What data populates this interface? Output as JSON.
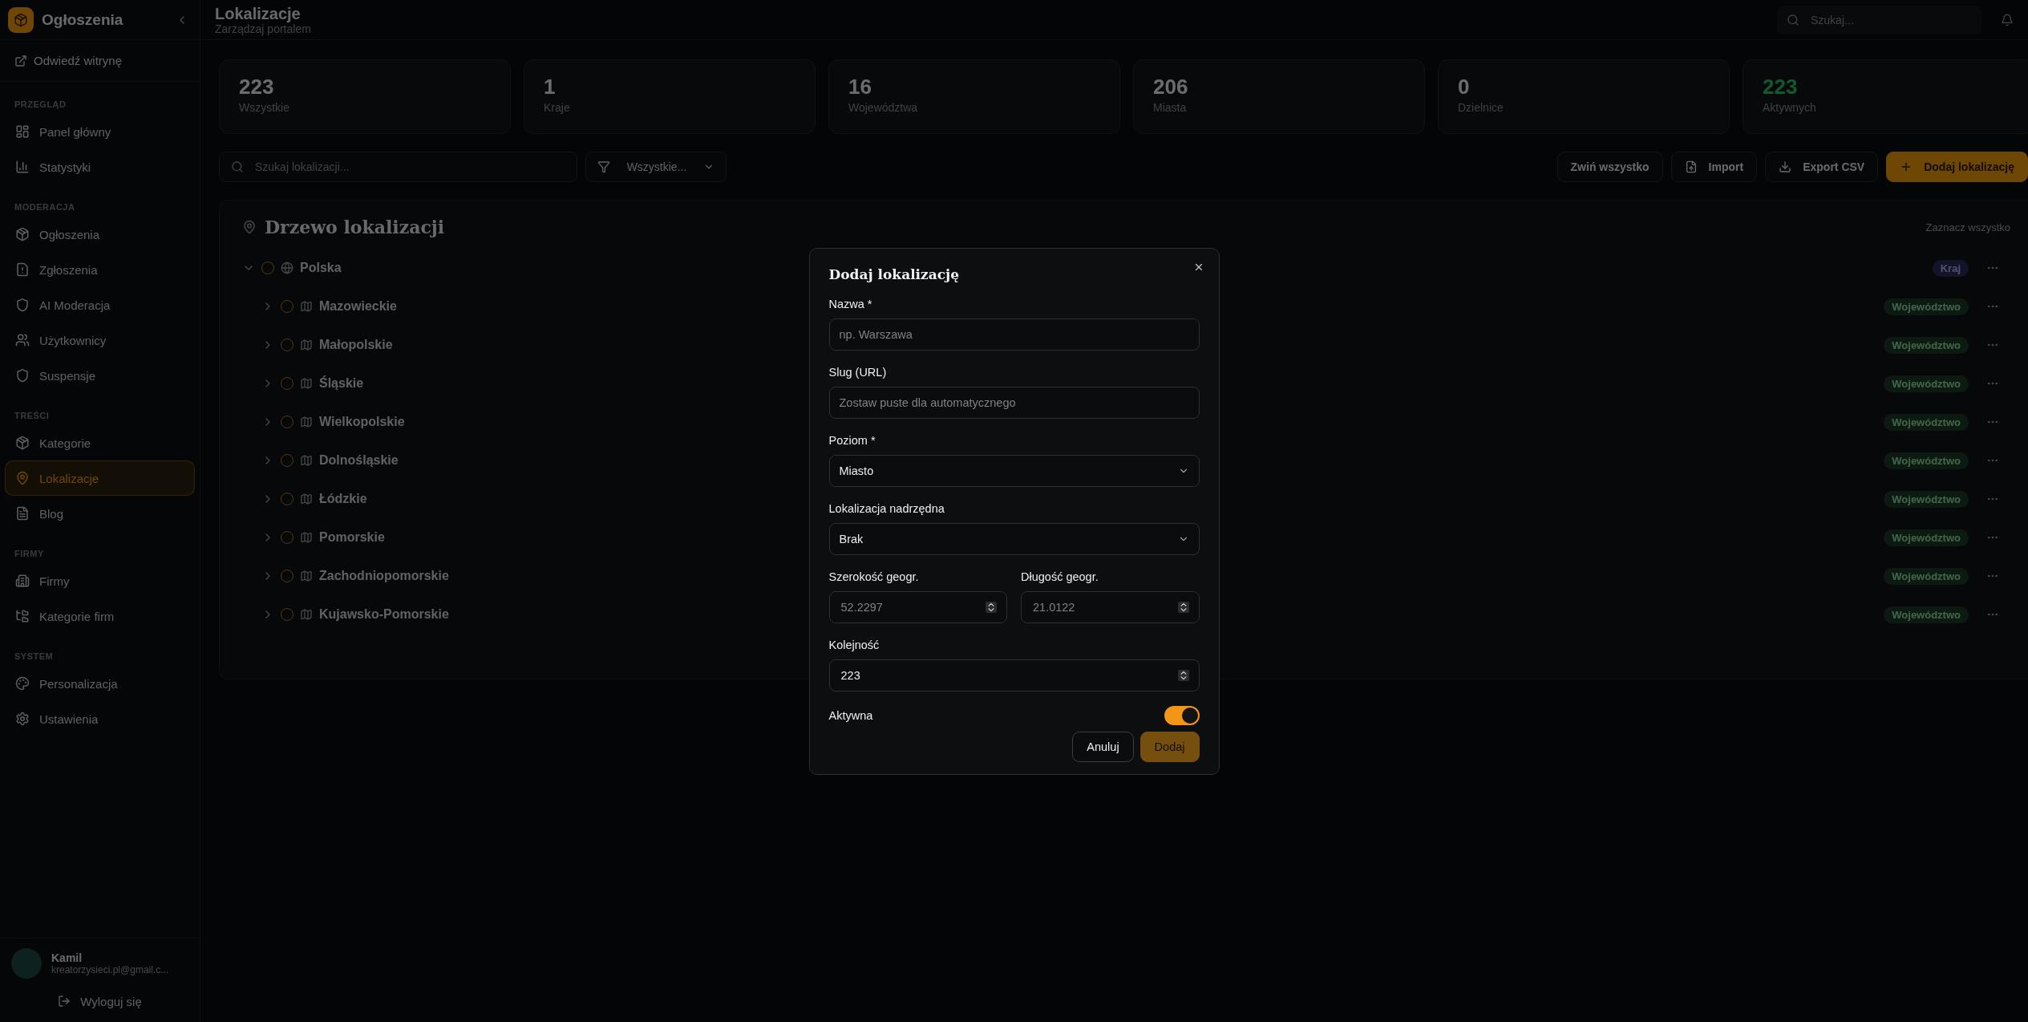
{
  "sidebar": {
    "brand": "Ogłoszenia",
    "visit_link": "Odwiedź witrynę",
    "sections": [
      {
        "title": "PRZEGLĄD",
        "items": [
          {
            "label": "Panel główny",
            "selected": false
          },
          {
            "label": "Statystyki",
            "selected": false
          }
        ]
      },
      {
        "title": "MODERACJA",
        "items": [
          {
            "label": "Ogłoszenia",
            "selected": false
          },
          {
            "label": "Zgłoszenia",
            "selected": false
          },
          {
            "label": "AI Moderacja",
            "selected": false
          },
          {
            "label": "Użytkownicy",
            "selected": false
          },
          {
            "label": "Suspensje",
            "selected": false
          }
        ]
      },
      {
        "title": "TREŚCI",
        "items": [
          {
            "label": "Kategorie",
            "selected": false
          },
          {
            "label": "Lokalizacje",
            "selected": true
          },
          {
            "label": "Blog",
            "selected": false
          }
        ]
      },
      {
        "title": "FIRMY",
        "items": [
          {
            "label": "Firmy",
            "selected": false
          },
          {
            "label": "Kategorie firm",
            "selected": false
          }
        ]
      },
      {
        "title": "SYSTEM",
        "items": [
          {
            "label": "Personalizacja",
            "selected": false
          },
          {
            "label": "Ustawienia",
            "selected": false
          }
        ]
      }
    ],
    "user": {
      "name": "Kamil",
      "email": "kreatorzysieci.pl@gmail.c..."
    },
    "logout": "Wyloguj się"
  },
  "header": {
    "title": "Lokalizacje",
    "subtitle": "Zarządzaj portalem",
    "search": {
      "placeholder": "Szukaj..."
    }
  },
  "stats": [
    {
      "value": "223",
      "label": "Wszystkie",
      "kind": "count"
    },
    {
      "value": "1",
      "label": "Kraje",
      "kind": "count"
    },
    {
      "value": "16",
      "label": "Województwa",
      "kind": "count"
    },
    {
      "value": "206",
      "label": "Miasta",
      "kind": "count"
    },
    {
      "value": "0",
      "label": "Dzielnice",
      "kind": "count"
    },
    {
      "value": "223",
      "label": "Aktywnych",
      "kind": "active"
    }
  ],
  "toolbar": {
    "search": {
      "placeholder": "Szukaj lokalizacji..."
    },
    "filter": "Wszystkie...",
    "buttons": [
      {
        "label": "Zwiń wszystko",
        "kind": "plain"
      },
      {
        "label": "Import",
        "kind": "import"
      },
      {
        "label": "Export CSV",
        "kind": "export"
      },
      {
        "label": "Dodaj lokalizację",
        "kind": "add"
      }
    ]
  },
  "tree": {
    "title": "Drzewo lokalizacji",
    "select_all": "Zaznacz wszystko",
    "nodes": [
      {
        "name": "Polska",
        "kind": "country",
        "badge": "Kraj",
        "expanded": true,
        "checked": false,
        "children": [
          {
            "name": "Mazowieckie",
            "kind": "region",
            "badge": "Województwo",
            "expanded": false,
            "checked": false
          },
          {
            "name": "Małopolskie",
            "kind": "region",
            "badge": "Województwo",
            "expanded": false,
            "checked": false
          },
          {
            "name": "Śląskie",
            "kind": "region",
            "badge": "Województwo",
            "expanded": false,
            "checked": false
          },
          {
            "name": "Wielkopolskie",
            "kind": "region",
            "badge": "Województwo",
            "expanded": false,
            "checked": false
          },
          {
            "name": "Dolnośląskie",
            "kind": "region",
            "badge": "Województwo",
            "expanded": false,
            "checked": false
          },
          {
            "name": "Łódzkie",
            "kind": "region",
            "badge": "Województwo",
            "expanded": false,
            "checked": false
          },
          {
            "name": "Pomorskie",
            "kind": "region",
            "badge": "Województwo",
            "expanded": false,
            "checked": false
          },
          {
            "name": "Zachodniopomorskie",
            "kind": "region",
            "badge": "Województwo",
            "expanded": false,
            "checked": false
          },
          {
            "name": "Kujawsko-Pomorskie",
            "kind": "region",
            "badge": "Województwo",
            "expanded": false,
            "checked": false
          }
        ]
      }
    ]
  },
  "dialog": {
    "title": "Dodaj lokalizację",
    "fields": [
      {
        "kind": "text",
        "label": "Nazwa *",
        "placeholder": "np. Warszawa"
      },
      {
        "kind": "text",
        "label": "Slug (URL)",
        "placeholder": "Zostaw puste dla automatycznego"
      },
      {
        "kind": "select",
        "label": "Poziom *",
        "value": "Miasto"
      },
      {
        "kind": "select",
        "label": "Lokalizacja nadrzędna",
        "value": "Brak"
      },
      {
        "kind": "pair",
        "items": [
          {
            "label": "Szerokość geogr.",
            "placeholder": "52.2297"
          },
          {
            "label": "Długość geogr.",
            "placeholder": "21.0122"
          }
        ]
      },
      {
        "kind": "number",
        "label": "Kolejność",
        "value": "223"
      },
      {
        "kind": "toggle",
        "label": "Aktywna",
        "on": true
      }
    ],
    "buttons": [
      {
        "label": "Anuluj",
        "kind": "outline",
        "disabled": false
      },
      {
        "label": "Dodaj",
        "kind": "primary",
        "disabled": true
      }
    ]
  }
}
